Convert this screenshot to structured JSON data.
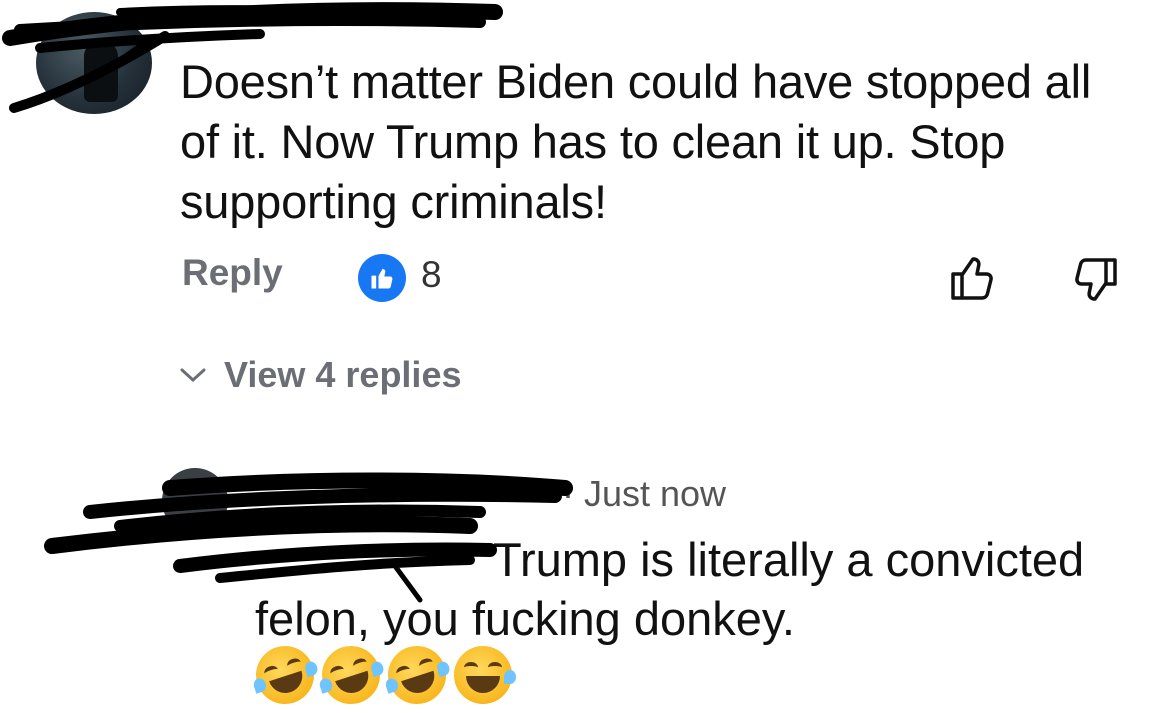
{
  "top_comment": {
    "text": "Doesn’t matter Biden could have stopped all of it. Now Trump has to clean it up. Stop supporting criminals!",
    "reply_label": "Reply",
    "like_count": "8",
    "view_replies_label": "View 4 replies"
  },
  "reply_comment": {
    "timestamp": "· Just now",
    "text": "Trump is literally a convicted felon, you fucking donkey.",
    "emojis": [
      "rolling-on-floor-laughing",
      "rolling-on-floor-laughing",
      "rolling-on-floor-laughing",
      "grinning-with-sweat"
    ]
  },
  "colors": {
    "like_blue": "#1877f2",
    "muted_text": "#6b6f75",
    "redaction": "#000000"
  }
}
